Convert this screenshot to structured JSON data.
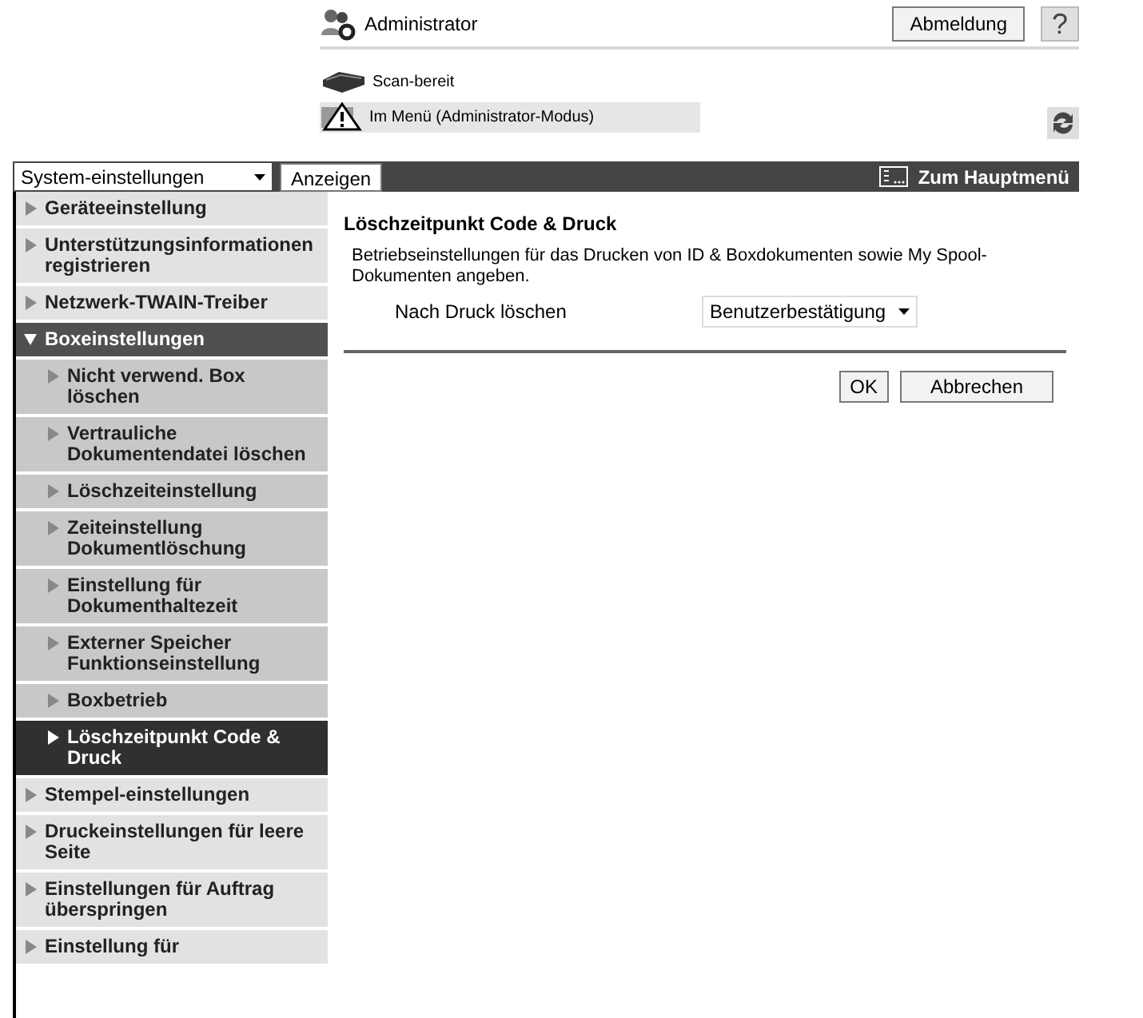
{
  "header": {
    "user": "Administrator",
    "logout_button": "Abmeldung",
    "help_button": "?",
    "status": "Scan-bereit",
    "mode": "Im Menü (Administrator-Modus)"
  },
  "toolbar": {
    "category_select": "System-einstellungen",
    "show_button": "Anzeigen",
    "main_menu_link": "Zum Hauptmenü"
  },
  "sidebar": {
    "items": [
      {
        "label": "Geräteeinstellung",
        "selected": false,
        "expanded": false
      },
      {
        "label": "Unterstützungsinformationen registrieren",
        "selected": false,
        "expanded": false
      },
      {
        "label": "Netzwerk-TWAIN-Treiber",
        "selected": false,
        "expanded": false
      },
      {
        "label": "Boxeinstellungen",
        "selected": false,
        "expanded": true,
        "children": [
          {
            "label": "Nicht verwend. Box löschen",
            "selected": false
          },
          {
            "label": "Vertrauliche Dokumentendatei löschen",
            "selected": false
          },
          {
            "label": "Löschzeiteinstellung",
            "selected": false
          },
          {
            "label": "Zeiteinstellung Dokumentlöschung",
            "selected": false
          },
          {
            "label": "Einstellung für Dokumenthaltezeit",
            "selected": false
          },
          {
            "label": "Externer Speicher Funktionseinstellung",
            "selected": false
          },
          {
            "label": "Boxbetrieb",
            "selected": false
          },
          {
            "label": "Löschzeitpunkt Code & Druck",
            "selected": true
          }
        ]
      },
      {
        "label": "Stempel-einstellungen",
        "selected": false,
        "expanded": false
      },
      {
        "label": "Druckeinstellungen für leere Seite",
        "selected": false,
        "expanded": false
      },
      {
        "label": "Einstellungen für Auftrag überspringen",
        "selected": false,
        "expanded": false
      },
      {
        "label": "Einstellung für",
        "selected": false,
        "expanded": false
      }
    ]
  },
  "content": {
    "title": "Löschzeitpunkt Code & Druck",
    "description": "Betriebseinstellungen für das Drucken von ID & Boxdokumenten sowie My Spool-Dokumenten angeben.",
    "settings": [
      {
        "label": "Nach Druck löschen",
        "value": "Benutzerbestätigung"
      }
    ],
    "buttons": [
      "OK",
      "Abbrechen"
    ]
  }
}
